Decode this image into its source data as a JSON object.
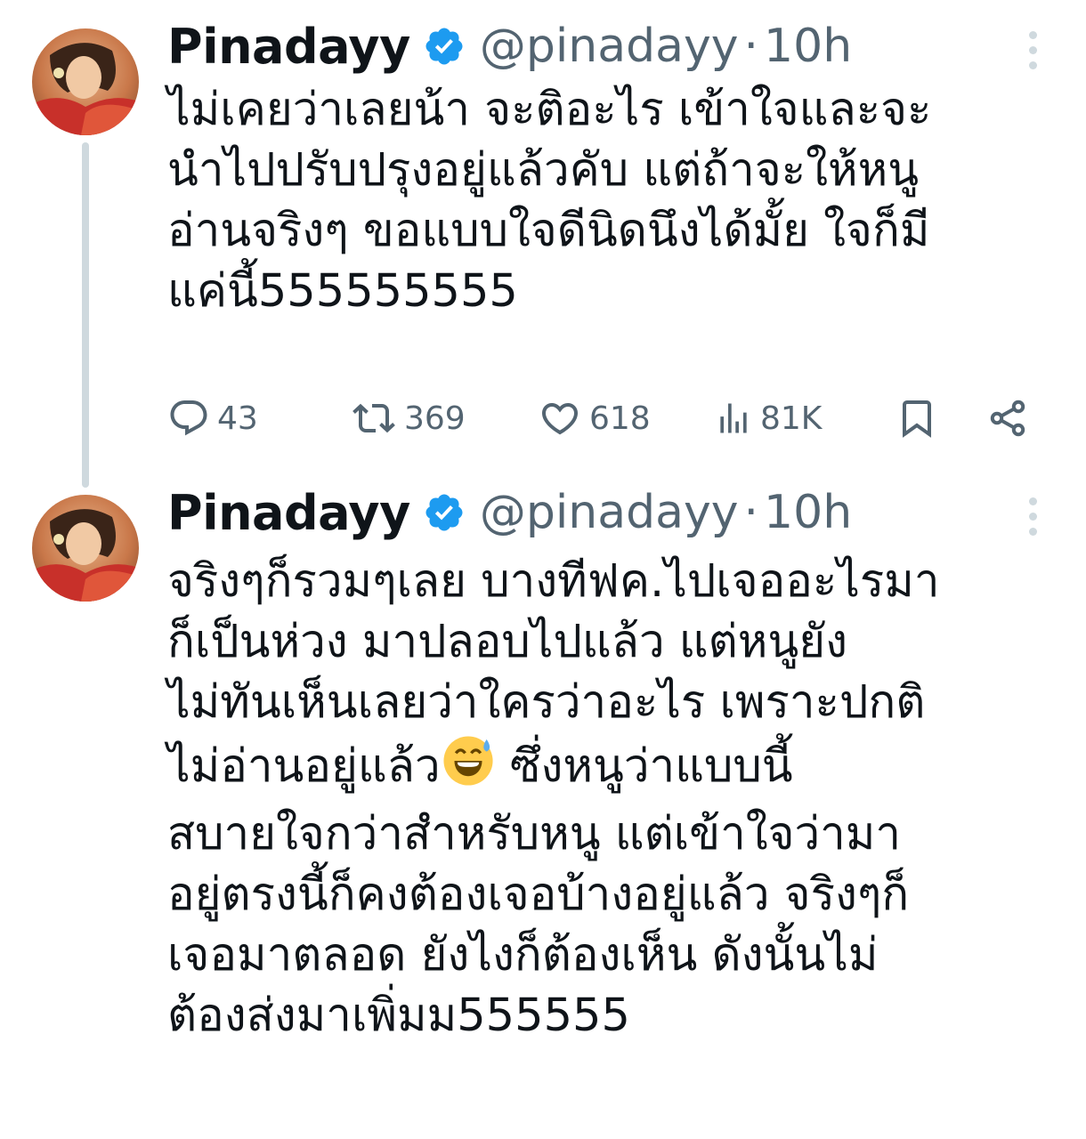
{
  "tweets": [
    {
      "author": {
        "name": "Pinadayy",
        "handle": "@pinadayy",
        "verified": true,
        "verified_color": "#1d9bf0"
      },
      "separator": "·",
      "time": "10h",
      "text": "ไม่เคยว่าเลยน้า จะติอะไร เข้าใจและจะ\nนำไปปรับปรุงอยู่แล้วคับ แต่ถ้าจะให้หนู\nอ่านจริงๆ ขอแบบใจดีนิดนึงได้มั้ย ใจก็มี\nแค่นี้555555555",
      "actions": {
        "replies": "43",
        "retweets": "369",
        "likes": "618",
        "views": "81K"
      },
      "icons": [
        "reply-icon",
        "retweet-icon",
        "like-icon",
        "views-icon",
        "bookmark-icon",
        "share-icon"
      ]
    },
    {
      "author": {
        "name": "Pinadayy",
        "handle": "@pinadayy",
        "verified": true,
        "verified_color": "#1d9bf0"
      },
      "separator": "·",
      "time": "10h",
      "text_before_emoji": "จริงๆก็รวมๆเลย บางทีฟค.ไปเจออะไรมา\nก็เป็นห่วง มาปลอบไปแล้ว แต่หนูยัง\nไม่ทันเห็นเลยว่าใครว่าอะไร เพราะปกติ\nไม่อ่านอยู่แล้ว",
      "emoji": "grinning-face-with-sweat",
      "text_after_emoji": " ซึ่งหนูว่าแบบนี้\nสบายใจกว่าสำหรับหนู แต่เข้าใจว่ามา\nอยู่ตรงนี้ก็คงต้องเจอบ้างอยู่แล้ว จริงๆก็\nเจอมาตลอด ยังไงก็ต้องเห็น ดังนั้นไม่\nต้องส่งมาเพิ่มม555555"
    }
  ],
  "colors": {
    "text_primary": "#0f1419",
    "text_secondary": "#536471",
    "thread_line": "#cfd9de",
    "verified_badge": "#1d9bf0"
  }
}
